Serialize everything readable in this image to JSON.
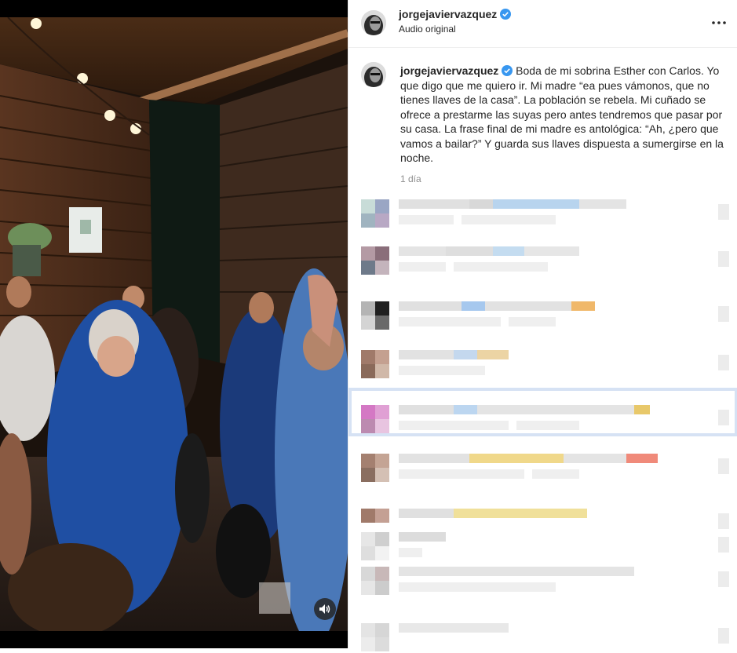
{
  "post": {
    "username": "jorgejaviervazquez",
    "audio_label": "Audio original",
    "caption": "Boda de mi sobrina Esther con Carlos. Yo que digo que me quiero ir. Mi madre “ea pues vámonos, que no tienes llaves de la casa”. La población se rebela. Mi cuñado se ofrece a prestarme las suyas pero antes tendremos que pasar por su casa. La frase final de mi madre es antológica: “Ah, ¿pero que vamos a bailar?” Y guarda sus llaves dispuesta a sumergirse en la noche.",
    "time": "1 día"
  },
  "icons": {
    "verified": "verified-badge-icon",
    "more": "more-options-icon",
    "mute": "speaker-icon"
  },
  "colors": {
    "verified": "#3897f0",
    "text": "#262626",
    "muted": "#8e8e8e",
    "highlight": "#d6e2f4"
  }
}
